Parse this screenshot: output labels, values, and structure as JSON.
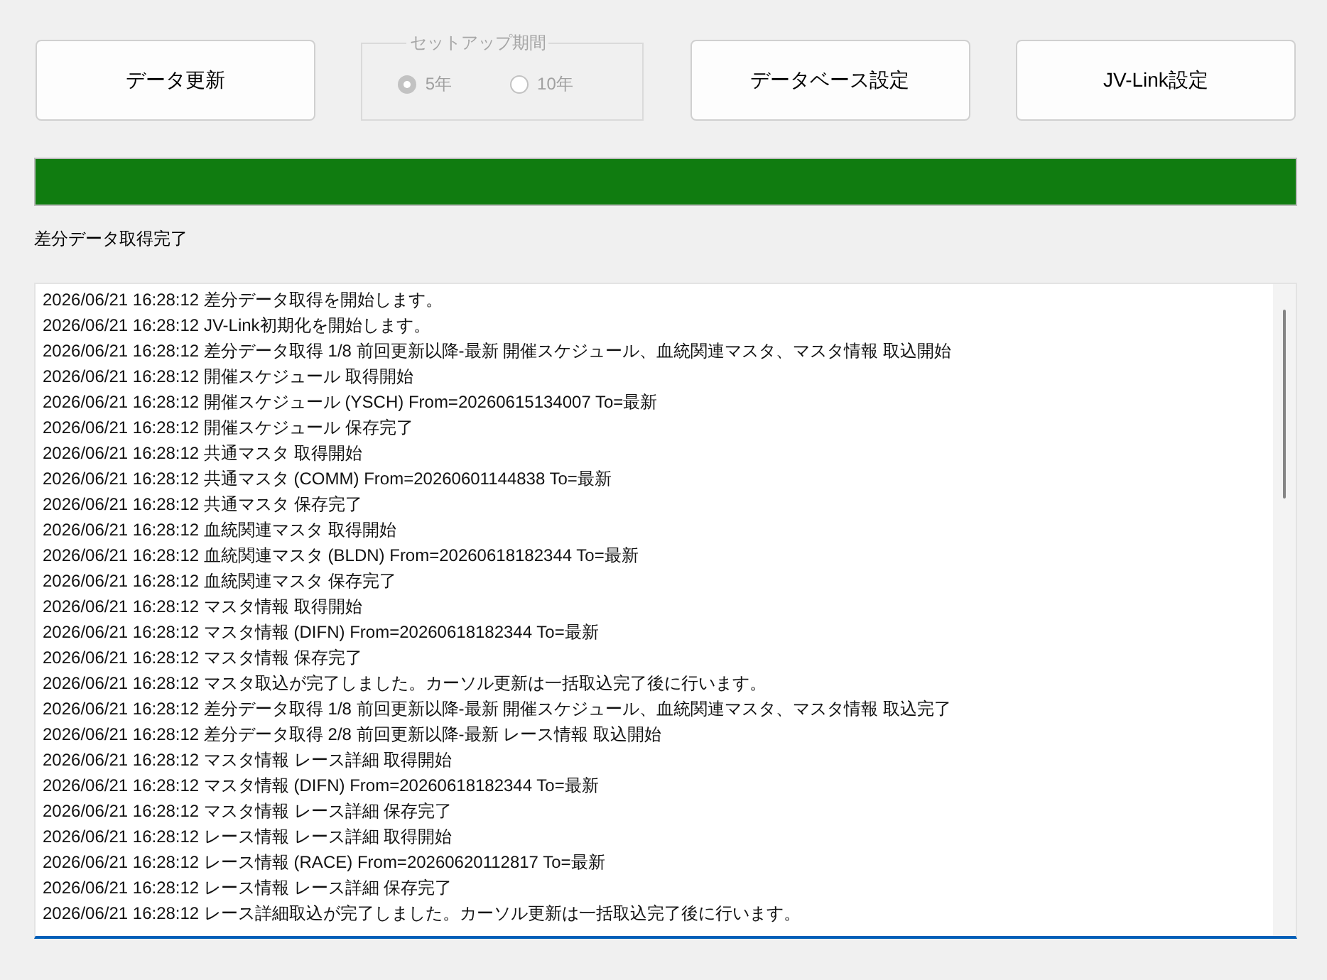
{
  "top_row": [
    {
      "kind": "button",
      "label": "データ更新"
    },
    {
      "kind": "group",
      "title": "セットアップ期間",
      "disabled": true,
      "options": [
        {
          "label": "5年",
          "selected": true
        },
        {
          "label": "10年",
          "selected": false
        }
      ]
    },
    {
      "kind": "button",
      "label": "データベース設定"
    },
    {
      "kind": "button",
      "label": "JV-Link設定"
    }
  ],
  "progress": {
    "level": 1
  },
  "status_text": "差分データ取得完了",
  "log": {
    "focused": true,
    "lines": [
      "2026/06/21 16:28:12 差分データ取得を開始します。",
      "2026/06/21 16:28:12 JV-Link初期化を開始します。",
      "2026/06/21 16:28:12 差分データ取得 1/8 前回更新以降-最新 開催スケジュール、血統関連マスタ、マスタ情報 取込開始",
      "2026/06/21 16:28:12 開催スケジュール 取得開始",
      "2026/06/21 16:28:12 開催スケジュール (YSCH) From=20260615134007 To=最新",
      "2026/06/21 16:28:12 開催スケジュール 保存完了",
      "2026/06/21 16:28:12 共通マスタ 取得開始",
      "2026/06/21 16:28:12 共通マスタ (COMM) From=20260601144838 To=最新",
      "2026/06/21 16:28:12 共通マスタ 保存完了",
      "2026/06/21 16:28:12 血統関連マスタ 取得開始",
      "2026/06/21 16:28:12 血統関連マスタ (BLDN) From=20260618182344 To=最新",
      "2026/06/21 16:28:12 血統関連マスタ 保存完了",
      "2026/06/21 16:28:12 マスタ情報 取得開始",
      "2026/06/21 16:28:12 マスタ情報 (DIFN) From=20260618182344 To=最新",
      "2026/06/21 16:28:12 マスタ情報 保存完了",
      "2026/06/21 16:28:12 マスタ取込が完了しました。カーソル更新は一括取込完了後に行います。",
      "2026/06/21 16:28:12 差分データ取得 1/8 前回更新以降-最新 開催スケジュール、血統関連マスタ、マスタ情報 取込完了",
      "2026/06/21 16:28:12 差分データ取得 2/8 前回更新以降-最新 レース情報 取込開始",
      "2026/06/21 16:28:12 マスタ情報 レース詳細 取得開始",
      "2026/06/21 16:28:12 マスタ情報 (DIFN) From=20260618182344 To=最新",
      "2026/06/21 16:28:12 マスタ情報 レース詳細 保存完了",
      "2026/06/21 16:28:12 レース情報 レース詳細 取得開始",
      "2026/06/21 16:28:12 レース情報 (RACE) From=20260620112817 To=最新",
      "2026/06/21 16:28:12 レース情報 レース詳細 保存完了",
      "2026/06/21 16:28:12 レース詳細取込が完了しました。カーソル更新は一括取込完了後に行います。"
    ]
  }
}
